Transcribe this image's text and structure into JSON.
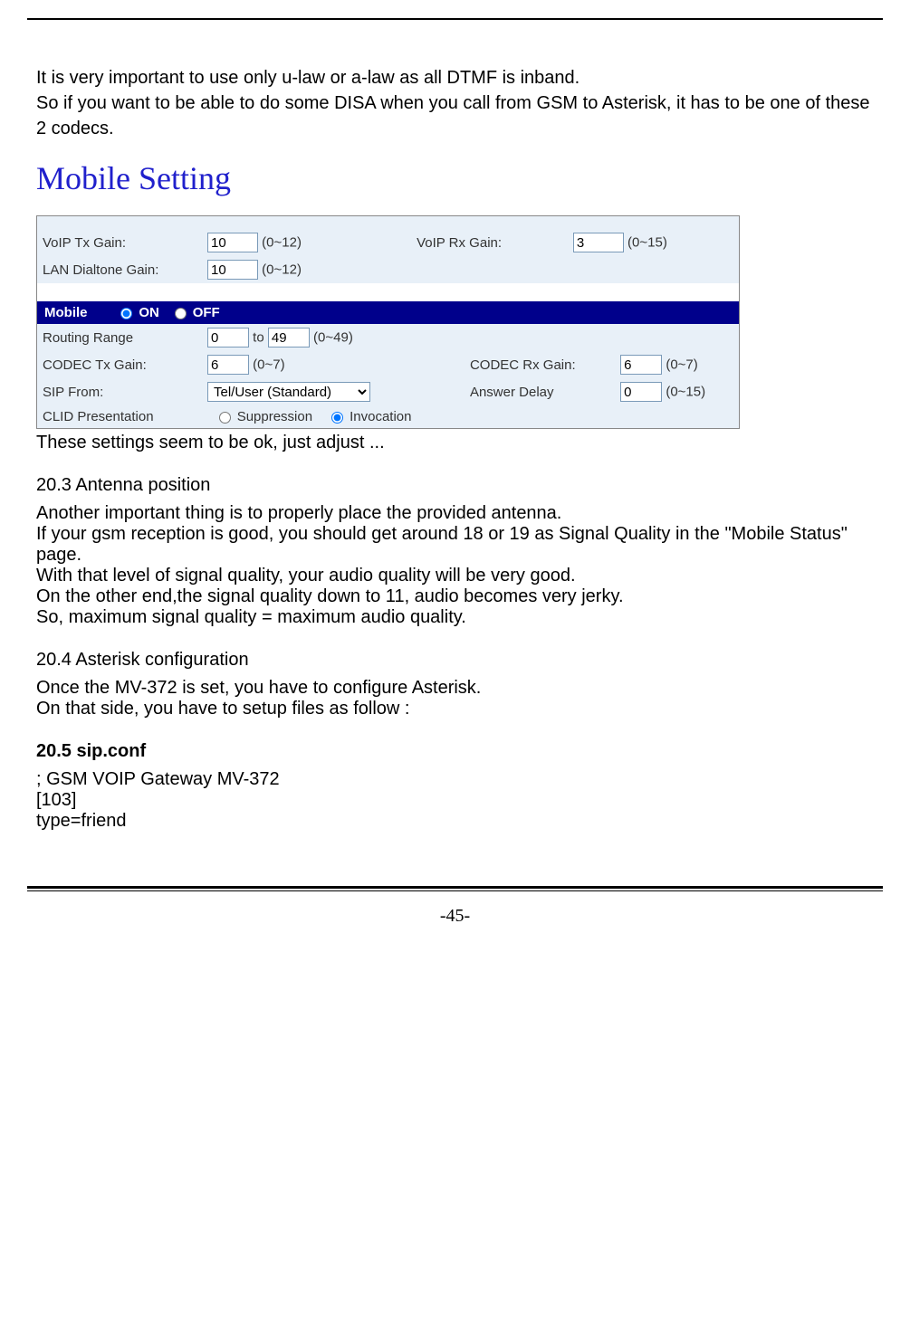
{
  "para1": "It is very important to use only u-law or a-law as all DTMF is inband.",
  "para2": "So if you want to be able to do some DISA when you call from GSM to Asterisk, it has to be one of these 2 codecs.",
  "mobile_setting_title": "Mobile Setting",
  "settings": {
    "voip_tx_gain_label": "VoIP Tx Gain:",
    "voip_tx_gain_value": "10",
    "voip_tx_gain_range": "(0~12)",
    "voip_rx_gain_label": "VoIP Rx Gain:",
    "voip_rx_gain_value": "3",
    "voip_rx_gain_range": "(0~15)",
    "lan_dialtone_gain_label": "LAN Dialtone Gain:",
    "lan_dialtone_gain_value": "10",
    "lan_dialtone_gain_range": "(0~12)",
    "mobile_label": "Mobile",
    "on_label": "ON",
    "off_label": "OFF",
    "routing_range_label": "Routing Range",
    "routing_range_from": "0",
    "routing_range_to_label": "to",
    "routing_range_to": "49",
    "routing_range_range": "(0~49)",
    "codec_tx_gain_label": "CODEC Tx Gain:",
    "codec_tx_gain_value": "6",
    "codec_tx_gain_range": "(0~7)",
    "codec_rx_gain_label": "CODEC Rx Gain:",
    "codec_rx_gain_value": "6",
    "codec_rx_gain_range": "(0~7)",
    "sip_from_label": "SIP From:",
    "sip_from_value": "Tel/User (Standard)",
    "answer_delay_label": "Answer Delay",
    "answer_delay_value": "0",
    "answer_delay_range": "(0~15)",
    "clid_label": "CLID Presentation",
    "clid_suppression": "Suppression",
    "clid_invocation": "Invocation"
  },
  "note_after": "These settings seem to be ok, just adjust ...",
  "section203": "20.3 Antenna position",
  "s203_p1": "Another important thing is to properly place the provided antenna.",
  "s203_p2": "If your gsm reception is good, you should get around 18 or 19 as Signal Quality in the \"Mobile Status\" page.",
  "s203_p3": "With that level of signal quality, your audio quality will be very good.",
  "s203_p4": "On the other end,the signal quality down to 11, audio becomes very jerky.",
  "s203_p5": "So, maximum signal quality = maximum audio quality.",
  "section204": "20.4 Asterisk configuration",
  "s204_p1": "Once the MV-372 is set, you have to configure Asterisk.",
  "s204_p2": "On that side, you have to setup files as follow :",
  "section205": "20.5 sip.conf",
  "s205_l1": "; GSM VOIP Gateway MV-372",
  "s205_l2": "[103]",
  "s205_l3": "type=friend",
  "page_number": "-45-"
}
